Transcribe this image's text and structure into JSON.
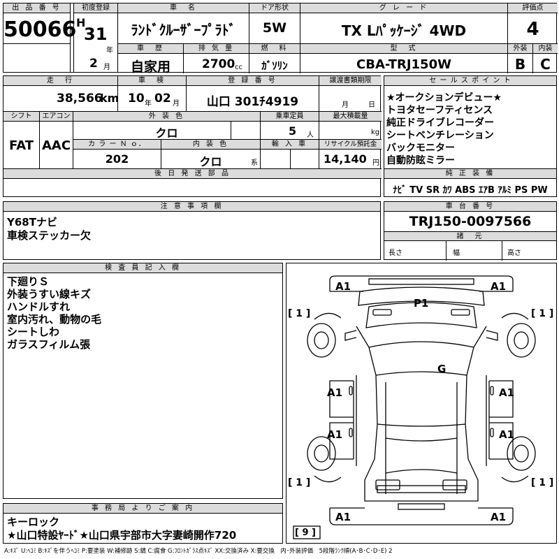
{
  "header": {
    "lot_label": "出 品 番 号",
    "lot_number": "50066",
    "reg_label": "初度登録",
    "era": "H",
    "reg_year": "31",
    "year_unit": "年",
    "reg_month": "2",
    "month_unit": "月",
    "car_name_label": "車　名",
    "car_name": "ﾗﾝﾄﾞｸﾙｰｻﾞｰﾌﾟﾗﾄﾞ",
    "door_label": "ドア形状",
    "door": "5W",
    "grade_label": "グ レ ー ド",
    "grade": "TX Lﾊﾟｯｹｰｼﾞ 4WD",
    "score_label": "評価点",
    "score": "4",
    "history_label": "車　歴",
    "history": "自家用",
    "displacement_label": "排 気 量",
    "displacement": "2700",
    "displacement_unit": "cc",
    "fuel_label": "燃　料",
    "fuel": "ｶﾞｿﾘﾝ",
    "model_label": "型　式",
    "model": "CBA-TRJ150W",
    "ext_label": "外装",
    "ext_grade": "B",
    "int_label": "内装",
    "int_grade": "C"
  },
  "row2": {
    "mileage_label": "走　行",
    "mileage": "38,566",
    "mileage_unit": "km",
    "inspection_label": "車　検",
    "insp_year": "10",
    "insp_year_unit": "年",
    "insp_month": "02",
    "insp_month_unit": "月",
    "plate_label": "登 録 番 号",
    "plate": "山口 301ﾁ4919",
    "transfer_label": "譲渡書類期限",
    "transfer_month_unit": "月",
    "transfer_day_unit": "日",
    "shift_label": "シフト",
    "shift": "FAT",
    "ac_label": "エアコン",
    "ac": "AAC",
    "ext_color_label": "外 装 色",
    "ext_color": "クロ",
    "capacity_label": "乗車定員",
    "capacity": "5",
    "capacity_unit": "人",
    "maxload_label": "最大積載量",
    "maxload_unit": "kg",
    "color_no_label": "カ ラ ー Ｎ ｏ．",
    "color_no": "202",
    "int_color_label": "内 装 色",
    "int_color": "クロ",
    "int_color_unit": "系",
    "import_label": "輸 入 車",
    "recycle_label": "リサイクル預託金",
    "recycle": "14,140",
    "recycle_unit": "円",
    "later_parts_label": "後 日 発 送 部 品"
  },
  "sales": {
    "label": "セ ー ル ス ポ イ ン ト",
    "items": [
      "★オークションデビュー★",
      "トヨタセーフティセンス",
      "純正ドライブレコーダー",
      "シートベンチレーション",
      "バックモニター",
      "自動防眩ミラー"
    ],
    "equip_label": "純 正 装 備",
    "equipment": "ﾅﾋﾞ TV SR ｶﾜ ABS ｴｱB ｱﾙﾐ PS PW"
  },
  "notes": {
    "label": "注 意 事 項 欄",
    "lines": [
      "Y68Tナビ",
      "車検ステッカー欠"
    ]
  },
  "chassis": {
    "label": "車 台 番 号",
    "number": "TRJ150-0097566",
    "dims_label": "諸　元",
    "length_label": "長さ",
    "width_label": "幅",
    "height_label": "高さ"
  },
  "inspector": {
    "label": "検 査 員 記 入 欄",
    "lines": [
      "下廻りＳ",
      "外装うすい線キズ",
      "ハンドルすれ",
      "室内汚れ、動物の毛",
      "シートしわ",
      "ガラスフィルム張"
    ]
  },
  "office": {
    "label": "事 務 局 よ り ご 案 内",
    "lines": [
      "キーロック",
      "★山口特設ﾔｰﾄﾞ★山口県宇部市大字妻崎開作720"
    ]
  },
  "diagram": {
    "marks": {
      "front_left": "A1",
      "front_right": "A1",
      "windshield": "P1",
      "roof": "G",
      "fl_door": "A1",
      "fr_door": "A1",
      "rl_door": "A1",
      "rr_door": "A1",
      "rear_left": "A1",
      "rear_right": "A1",
      "tire_fl": "[ 1 ]",
      "tire_fr": "[ 1 ]",
      "tire_rl": "[ 1 ]",
      "tire_rr": "[ 1 ]",
      "spare": "[ 9 ]"
    }
  },
  "legend": "A:ｷｽﾞ U:ﾍｺﾐ B:ｷｽﾞを伴うﾍｺﾐ P:要塗装 W:補修跡 S:錆 C:腐食 G:ﾌﾛﾝﾄｶﾞﾗｽ点ｷｽﾞ XX:交換済み X:要交換　内･外装評価　5段階ﾗﾝｸ順(A･B･C･D･E) 2"
}
